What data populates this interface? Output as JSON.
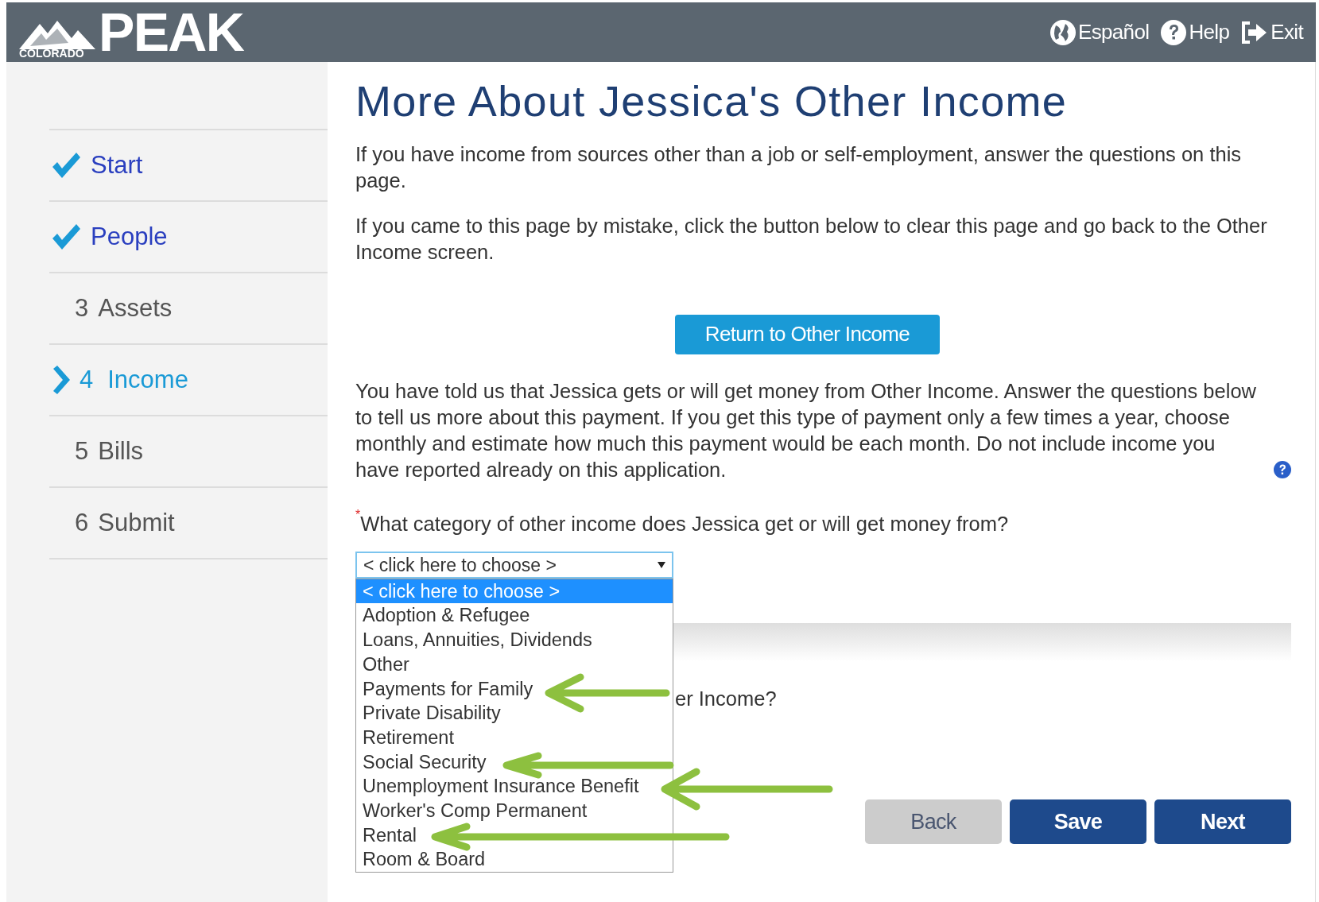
{
  "header": {
    "logo": {
      "wordmark": "PEAK",
      "state": "COLORADO"
    },
    "links": [
      {
        "kind": "globe",
        "label": "Español"
      },
      {
        "kind": "help",
        "label": "Help"
      },
      {
        "kind": "exit",
        "label": "Exit"
      }
    ]
  },
  "steps": [
    {
      "completed": true,
      "selected": false,
      "label": "Start"
    },
    {
      "completed": true,
      "selected": false,
      "label": "People"
    },
    {
      "completed": false,
      "selected": false,
      "number": "3",
      "label": "Assets"
    },
    {
      "completed": false,
      "selected": true,
      "number": "4",
      "label": "Income"
    },
    {
      "completed": false,
      "selected": false,
      "number": "5",
      "label": "Bills"
    },
    {
      "completed": false,
      "selected": false,
      "number": "6",
      "label": "Submit"
    }
  ],
  "title": "More About Jessica's Other Income",
  "intro": [
    "If you have income from sources other than a job or self-employment, answer the questions on this page.",
    "If you came to this page by mistake, click the button below to clear this page and go back to the Other Income screen."
  ],
  "return_button": "Return to Other Income",
  "explanation": "You have told us that Jessica gets or will get money from Other Income. Answer the questions below to tell us more about this payment. If you get this type of payment only a few times a year, choose monthly and estimate how much this payment would be each month. Do not include income you have reported already on this application.",
  "question": {
    "required_mark": "*",
    "label": "What category of other income does Jessica get or will get money from?"
  },
  "select": {
    "value": "< click here to choose >",
    "expanded": true,
    "options": [
      {
        "label": "< click here to choose >",
        "selected": true
      },
      {
        "label": "Adoption & Refugee",
        "selected": false
      },
      {
        "label": "Loans, Annuities, Dividends",
        "selected": false
      },
      {
        "label": "Other",
        "selected": false
      },
      {
        "label": "Payments for Family",
        "selected": false
      },
      {
        "label": "Private Disability",
        "selected": false
      },
      {
        "label": "Retirement",
        "selected": false
      },
      {
        "label": "Social Security",
        "selected": false
      },
      {
        "label": "Unemployment Insurance Benefit",
        "selected": false
      },
      {
        "label": "Worker's Comp Permanent",
        "selected": false
      },
      {
        "label": "Rental",
        "selected": false
      },
      {
        "label": "Room & Board",
        "selected": false
      }
    ]
  },
  "hidden_question_fragment": "er Income?",
  "nav_buttons": [
    {
      "kind": "secondary",
      "label": "Back"
    },
    {
      "kind": "primary",
      "label": "Save"
    },
    {
      "kind": "primary",
      "label": "Next"
    }
  ]
}
